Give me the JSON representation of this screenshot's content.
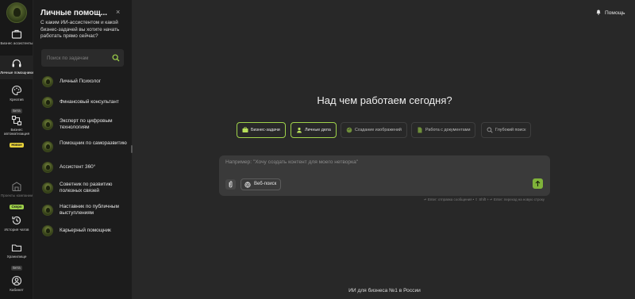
{
  "nav": {
    "items": [
      {
        "label": "Бизнес ассистенты",
        "badge": ""
      },
      {
        "label": "Личные помощники",
        "badge": ""
      },
      {
        "label": "Креатив",
        "badge": "Бета"
      },
      {
        "label": "Бизнес автоматизация",
        "badge": "Новое"
      },
      {
        "label": "Проекты компании",
        "badge": "Скоро"
      },
      {
        "label": "История чатов",
        "badge": ""
      },
      {
        "label": "Хранилище",
        "badge": "Бета"
      },
      {
        "label": "Кабинет",
        "badge": ""
      }
    ]
  },
  "panel": {
    "title": "Личные помощ...",
    "close": "×",
    "subtitle": "С каким ИИ-ассистентом и какой бизнес-задачей вы хотите начать работать прямо сейчас?",
    "search_placeholder": "Поиск по задачам",
    "assistants": [
      "Личный Психолог",
      "Финансовый консультант",
      "Эксперт по цифровым технологиям",
      "Помощник по саморазвитию",
      "Ассистент 360°",
      "Советник по развитию полезных связей",
      "Наставник по публичным выступлениям",
      "Карьерный помощник"
    ]
  },
  "header": {
    "help": "Помощь"
  },
  "main": {
    "headline": "Над чем работаем сегодня?",
    "chips": [
      "Бизнес-задачи",
      "Личные дела",
      "Создание изображений",
      "Работа с документами",
      "Глубокий поиск"
    ],
    "composer_placeholder": "Например: \"Хочу создать контент для моего нетворка\"",
    "web_search": "Веб-поиск",
    "hint": "↵ Enter: отправка сообщения  •  ⇧ Shift + ↵ Enter: переход на новую строку",
    "footer": "ИИ для бизнеса №1 в России"
  },
  "colors": {
    "accent": "#9fd24a",
    "background": "#282828",
    "panel": "#1c1c1c",
    "rail": "#181818"
  }
}
